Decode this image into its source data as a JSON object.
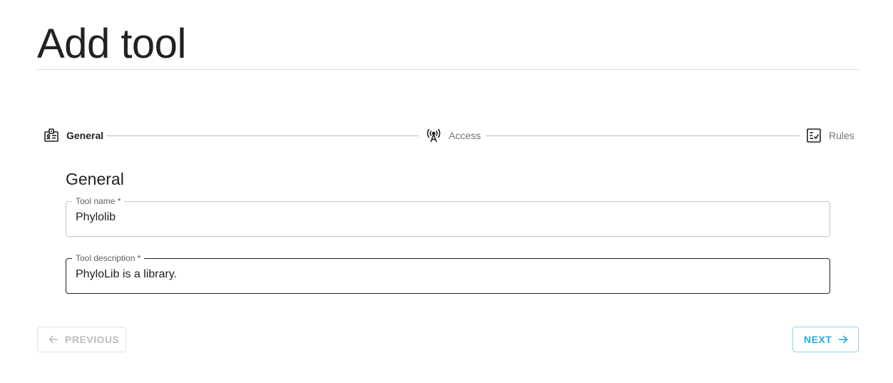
{
  "page": {
    "title": "Add tool"
  },
  "stepper": {
    "steps": [
      {
        "label": "General",
        "icon": "id-badge-icon",
        "state": "active"
      },
      {
        "label": "Access",
        "icon": "broadcast-antenna-icon",
        "state": "inactive"
      },
      {
        "label": "Rules",
        "icon": "checklist-icon",
        "state": "inactive"
      }
    ]
  },
  "form": {
    "section_heading": "General",
    "fields": {
      "tool_name": {
        "label": "Tool name *",
        "value": "Phylolib"
      },
      "tool_description": {
        "label": "Tool description *",
        "value": "PhyloLib is a library."
      }
    }
  },
  "actions": {
    "previous_label": "PREVIOUS",
    "next_label": "NEXT"
  },
  "colors": {
    "accent": "#29a9e0",
    "accent_border": "#8fd3ef",
    "disabled": "#bdbdbd",
    "text": "#212121"
  }
}
